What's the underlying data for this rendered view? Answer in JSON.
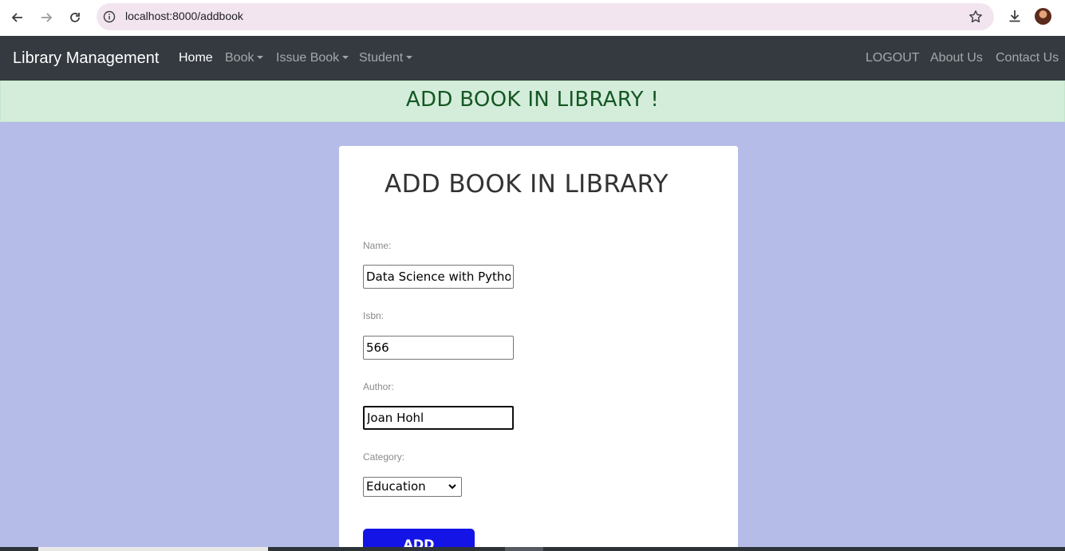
{
  "browser": {
    "url": "localhost:8000/addbook"
  },
  "navbar": {
    "brand": "Library Management",
    "links": [
      {
        "label": "Home",
        "active": true
      },
      {
        "label": "Book",
        "dropdown": true
      },
      {
        "label": "Issue Book",
        "dropdown": true
      },
      {
        "label": "Student",
        "dropdown": true
      }
    ],
    "right_links": [
      {
        "label": "LOGOUT"
      },
      {
        "label": "About Us"
      },
      {
        "label": "Contact Us"
      }
    ]
  },
  "alert": {
    "message": "ADD BOOK IN LIBRARY !"
  },
  "form": {
    "title": "ADD BOOK IN LIBRARY",
    "name_label": "Name:",
    "name_value": "Data Science with Python",
    "isbn_label": "Isbn:",
    "isbn_value": "566",
    "author_label": "Author:",
    "author_value": "Joan Hohl",
    "category_label": "Category:",
    "category_value": "Education",
    "submit_label": "ADD"
  },
  "colors": {
    "page_bg": "#b5bce8",
    "navbar_bg": "#343a40",
    "alert_bg": "#d4edda",
    "alert_text": "#155724",
    "button_bg": "#1414e6"
  },
  "icons": [
    "back-arrow-icon",
    "forward-arrow-icon",
    "reload-icon",
    "site-info-icon",
    "bookmark-star-icon",
    "download-icon",
    "profile-avatar-icon",
    "chevron-down-icon"
  ]
}
